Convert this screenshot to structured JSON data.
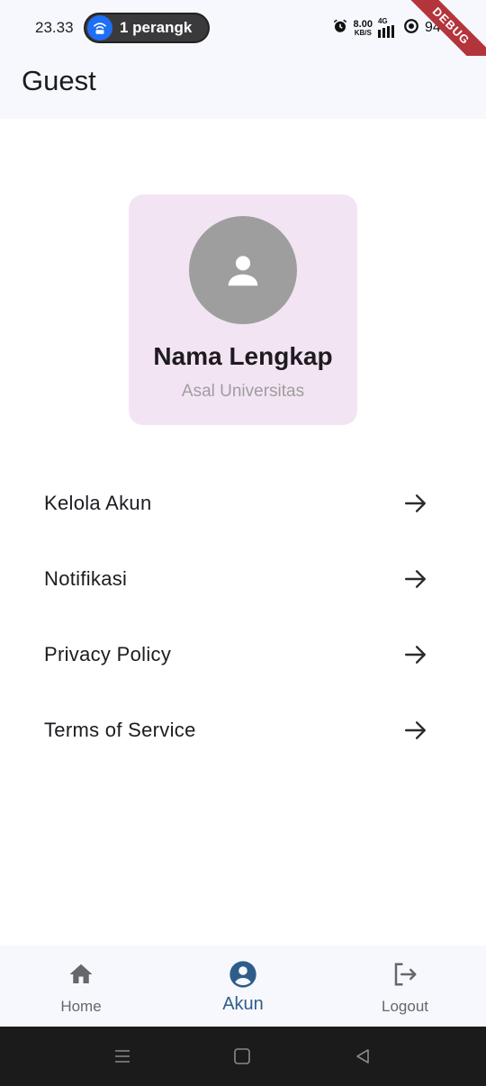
{
  "status_bar": {
    "time": "23.33",
    "hotspot_text": "1 perangk",
    "net_speed_value": "8.00",
    "net_speed_unit": "KB/S",
    "network_type": "4G",
    "battery": "94%",
    "debug_label": "DEBUG"
  },
  "app_bar": {
    "title": "Guest"
  },
  "profile": {
    "name": "Nama Lengkap",
    "university": "Asal Universitas"
  },
  "menu": [
    {
      "label": "Kelola Akun",
      "icon": "arrow-right-icon"
    },
    {
      "label": "Notifikasi",
      "icon": "arrow-right-icon"
    },
    {
      "label": "Privacy Policy",
      "icon": "arrow-right-icon"
    },
    {
      "label": "Terms of Service",
      "icon": "arrow-right-icon"
    }
  ],
  "bottom_nav": [
    {
      "label": "Home",
      "icon": "home-icon",
      "active": false
    },
    {
      "label": "Akun",
      "icon": "account-circle-icon",
      "active": true
    },
    {
      "label": "Logout",
      "icon": "logout-icon",
      "active": false
    }
  ],
  "colors": {
    "card_background": "#f3e4f3",
    "avatar_background": "#9e9e9e",
    "active_nav": "#2f5d8a",
    "bar_background": "#f7f8fd",
    "debug_banner": "#b3353b"
  }
}
